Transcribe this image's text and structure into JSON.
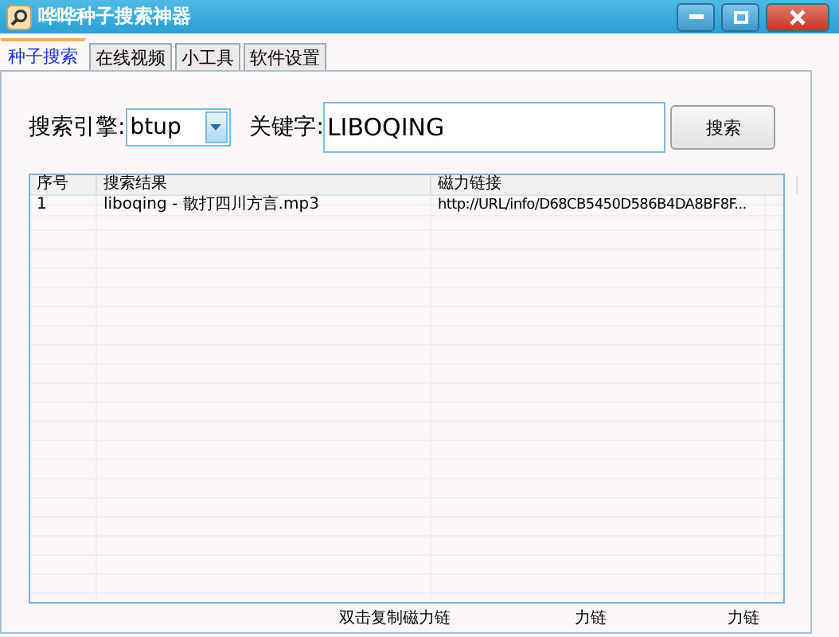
{
  "window": {
    "title": "哗哗种子搜索神器"
  },
  "tabs": [
    {
      "label": "种子搜索",
      "selected": true
    },
    {
      "label": "在线视频",
      "selected": false
    },
    {
      "label": "小工具",
      "selected": false
    },
    {
      "label": "软件设置",
      "selected": false
    }
  ],
  "search": {
    "engine_label": "搜索引擎:",
    "engine": "btup",
    "keyword_label": "关键字:",
    "keyword": "LIBOQING",
    "button": "搜索"
  },
  "table": {
    "columns": [
      "序号",
      "搜索结果",
      "磁力链接"
    ],
    "rows": [
      {
        "cells": [
          "1",
          "liboqing - 散打四川方言.mp3",
          "http://URL/info/D68CB5450D586B4DA8BF8F..."
        ],
        "selected": false
      }
    ]
  },
  "status_bar": [
    "双击复制磁力链",
    "力链",
    "力链"
  ]
}
